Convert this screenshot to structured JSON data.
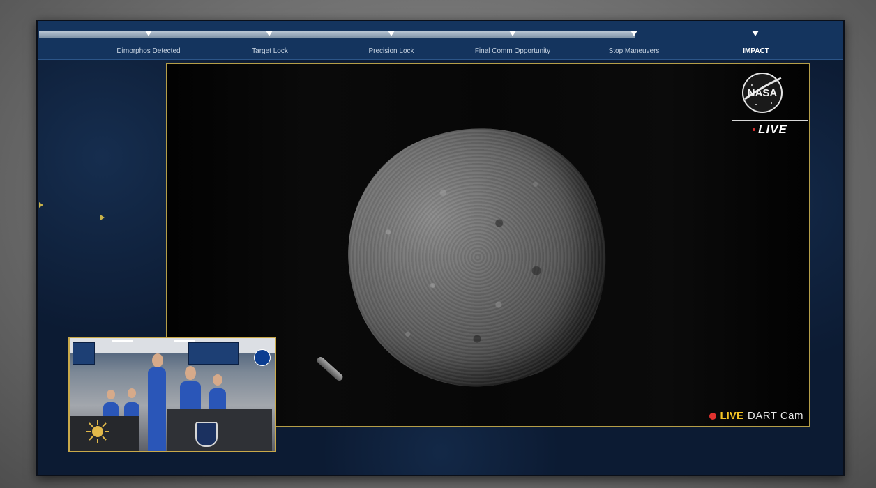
{
  "timeline": {
    "milestones": [
      {
        "label": "Dimorphos Detected"
      },
      {
        "label": "Target Lock"
      },
      {
        "label": "Precision Lock"
      },
      {
        "label": "Final Comm Opportunity"
      },
      {
        "label": "Stop Maneuvers"
      },
      {
        "label": "IMPACT"
      }
    ]
  },
  "camera": {
    "logo_icon": "nasa-logo",
    "live_badge": "LIVE",
    "feed_live_word": "LIVE",
    "feed_name": "DART Cam"
  },
  "pip": {
    "shield_icon": "apl-shield",
    "sun_icon": "cbs-sun"
  },
  "colors": {
    "frame_bg": "#0c1b33",
    "timeline_bg": "#14345e",
    "cam_border": "#b59e48",
    "live_red": "#e0322f",
    "live_yellow": "#f3c325"
  }
}
